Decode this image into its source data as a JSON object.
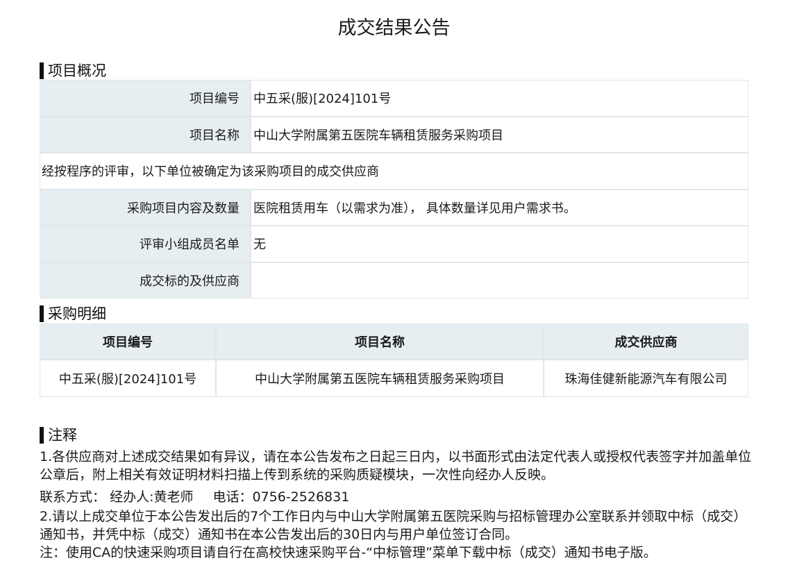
{
  "title": "成交结果公告",
  "overview": {
    "heading": "项目概况",
    "project_no_label": "项目编号",
    "project_no": "中五采(服)[2024]101号",
    "project_name_label": "项目名称",
    "project_name": "中山大学附属第五医院车辆租赁服务采购项目",
    "evaluation_note": "经按程序的评审，以下单位被确定为该采购项目的成交供应商",
    "content_label": "采购项目内容及数量",
    "content": "医院租赁用车（以需求为准）， 具体数量详见用户需求书。",
    "panel_label": "评审小组成员名单",
    "panel": "无",
    "winner_label": "成交标的及供应商",
    "winner": ""
  },
  "detail": {
    "heading": "采购明细",
    "columns": [
      "项目编号",
      "项目名称",
      "成交供应商"
    ],
    "rows": [
      [
        "中五采(服)[2024]101号",
        "中山大学附属第五医院车辆租赁服务采购项目",
        "珠海佳健新能源汽车有限公司"
      ]
    ]
  },
  "notes": {
    "heading": "注释",
    "item1": "1.各供应商对上述成交结果如有异议，请在本公告发布之日起三日内，以书面形式由法定代表人或授权代表签字并加盖单位公章后，附上相关有效证明材料扫描上传到系统的采购质疑模块，一次性向经办人反映。",
    "contact_label": "联系方式：",
    "contact_person": "经办人:黄老师",
    "contact_phone": "电话：0756-2526831",
    "item2": "2.请以上成交单位于本公告发出后的7个工作日内与中山大学附属第五医院采购与招标管理办公室联系并领取中标（成交）通知书，并凭中标（成交）通知书在本公告发出后的30日内与用户单位签订合同。",
    "item3": "注：使用CA的快速采购项目请自行在高校快速采购平台-“中标管理”菜单下载中标（成交）通知书电子版。"
  }
}
